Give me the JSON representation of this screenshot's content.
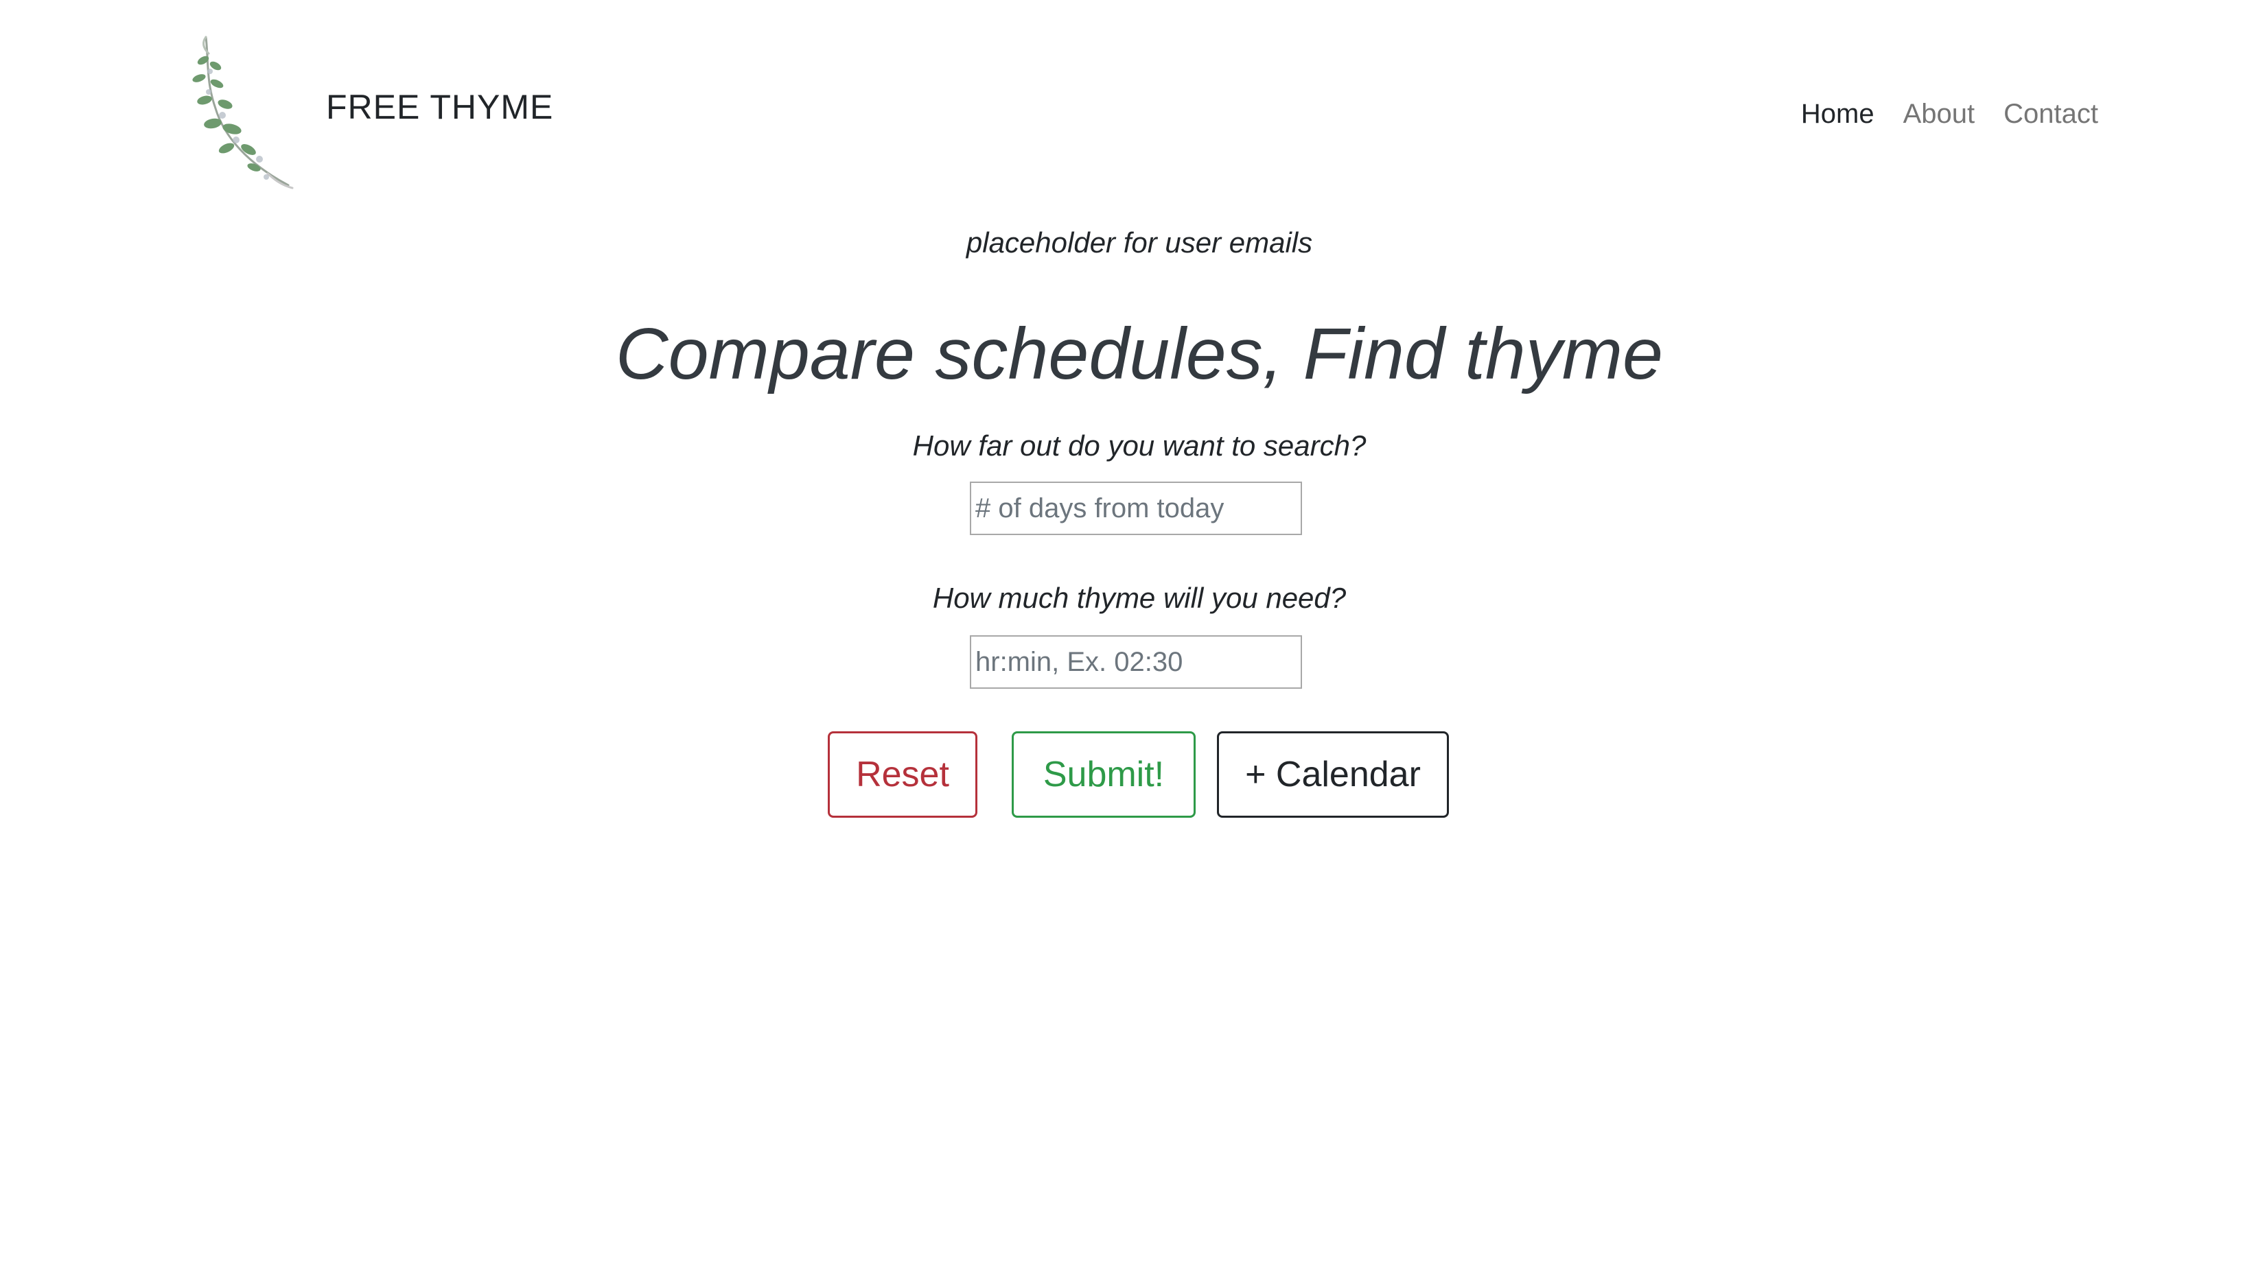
{
  "navbar": {
    "brand": "FREE THYME",
    "logo_icon": "thyme-sprig-icon",
    "links": [
      {
        "label": "Home",
        "active": true
      },
      {
        "label": "About",
        "active": false
      },
      {
        "label": "Contact",
        "active": false
      }
    ]
  },
  "main": {
    "user_emails_text": "placeholder for user emails",
    "headline": "Compare schedules, Find thyme",
    "days_question": "How far out do you want to search?",
    "days_placeholder": "# of days from today",
    "duration_question": "How much thyme will you need?",
    "duration_placeholder": "hr:min, Ex. 02:30"
  },
  "buttons": {
    "reset_label": "Reset",
    "submit_label": "Submit!",
    "calendar_label": "+ Calendar"
  },
  "colors": {
    "reset": "#b5313b",
    "submit": "#2e9a48",
    "calendar": "#212529",
    "nav_inactive": "#757575",
    "logo_leaf": "#6e9a6e"
  }
}
